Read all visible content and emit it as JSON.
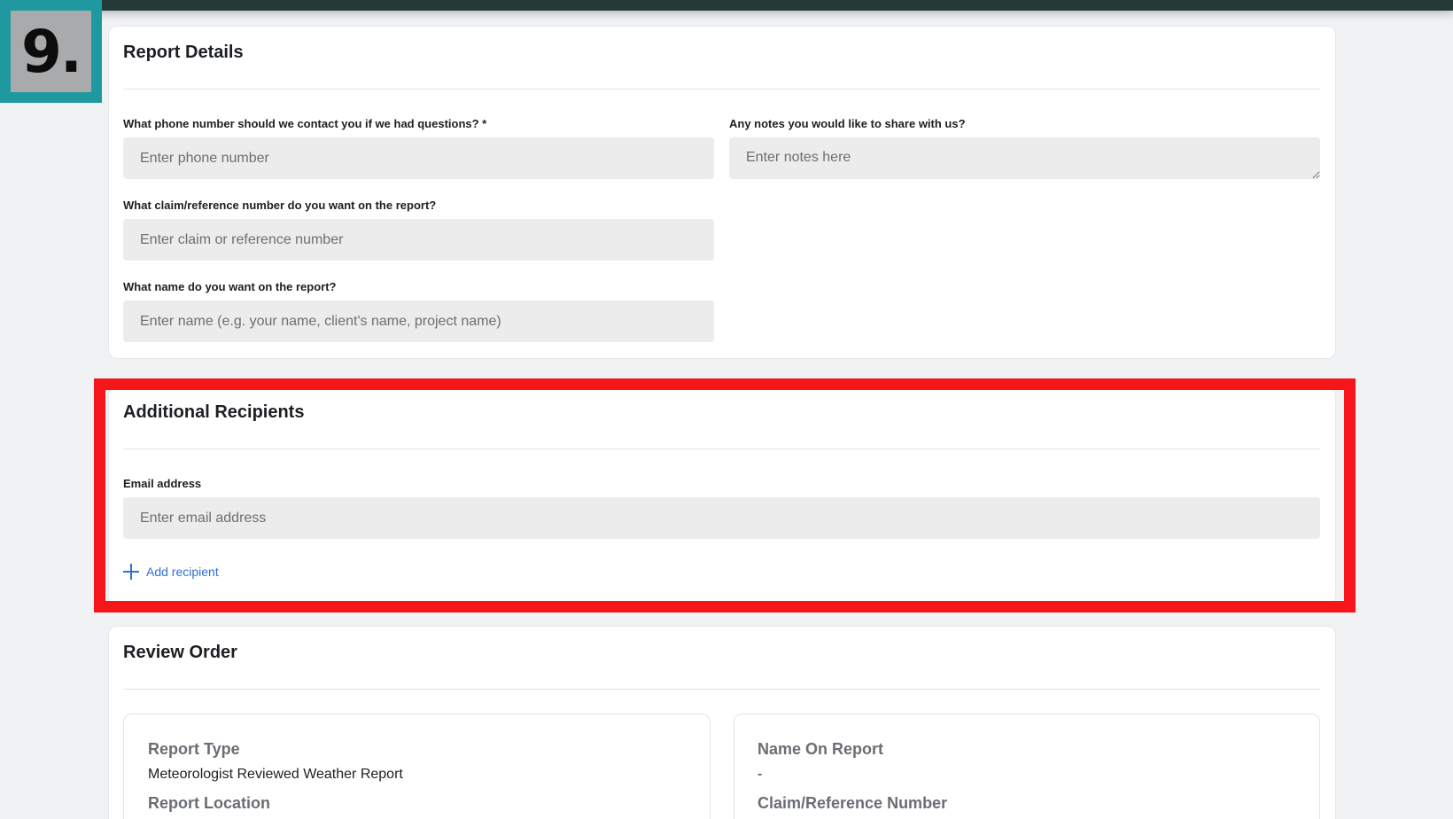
{
  "step_badge": {
    "label": "9."
  },
  "report_details": {
    "title": "Report Details",
    "phone": {
      "label": "What phone number should we contact you if we had questions? *",
      "placeholder": "Enter phone number",
      "value": ""
    },
    "notes": {
      "label": "Any notes you would like to share with us?",
      "placeholder": "Enter notes here",
      "value": ""
    },
    "claim": {
      "label": "What claim/reference number do you want on the report?",
      "placeholder": "Enter claim or reference number",
      "value": ""
    },
    "name": {
      "label": "What name do you want on the report?",
      "placeholder": "Enter name (e.g. your name, client's name, project name)",
      "value": ""
    }
  },
  "additional_recipients": {
    "title": "Additional Recipients",
    "email": {
      "label": "Email address",
      "placeholder": "Enter email address",
      "value": ""
    },
    "add_recipient_label": "Add recipient",
    "add_icon": "plus-icon",
    "highlight_color": "#f5151a"
  },
  "review_order": {
    "title": "Review Order",
    "left": {
      "report_type_label": "Report Type",
      "report_type_value": "Meteorologist Reviewed Weather Report",
      "report_location_label": "Report Location"
    },
    "right": {
      "name_on_report_label": "Name On Report",
      "name_on_report_value": "-",
      "claim_label": "Claim/Reference Number"
    }
  },
  "colors": {
    "top_bar": "#233a37",
    "badge_frame": "#1f98a0",
    "link_blue": "#2f6fd8",
    "input_bg": "#ececec"
  }
}
